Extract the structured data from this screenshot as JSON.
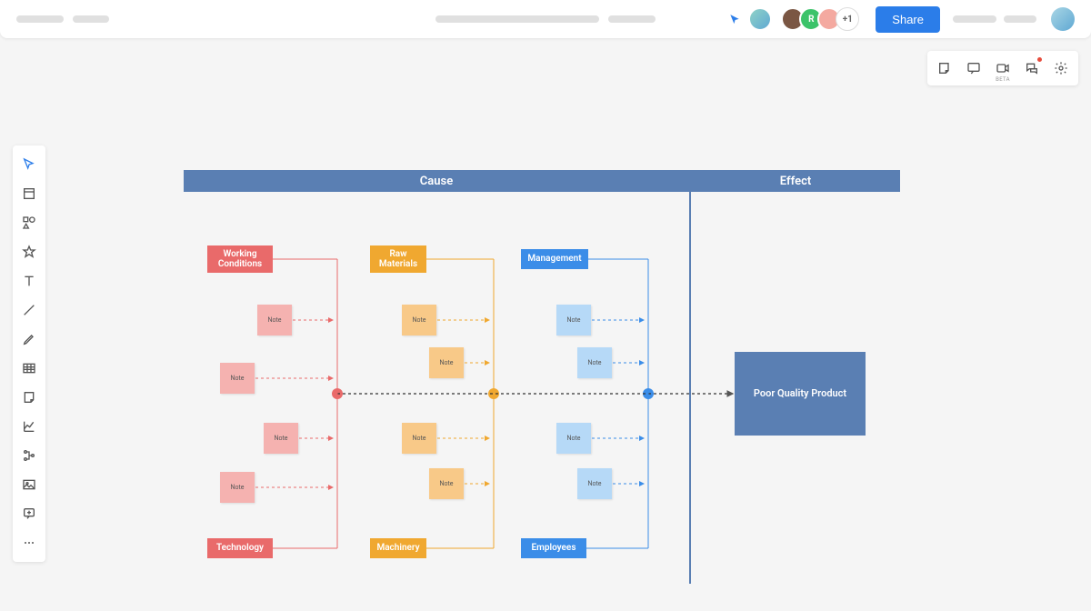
{
  "topbar": {
    "share_label": "Share",
    "overflow_label": "+1"
  },
  "headers": {
    "cause": "Cause",
    "effect": "Effect"
  },
  "causes": {
    "top": [
      "Working Conditions",
      "Raw Materials",
      "Management"
    ],
    "bottom": [
      "Technology",
      "Machinery",
      "Employees"
    ]
  },
  "note_label": "Note",
  "effect_box": "Poor Quality Product",
  "right_icons": {
    "beta": "BETA"
  }
}
